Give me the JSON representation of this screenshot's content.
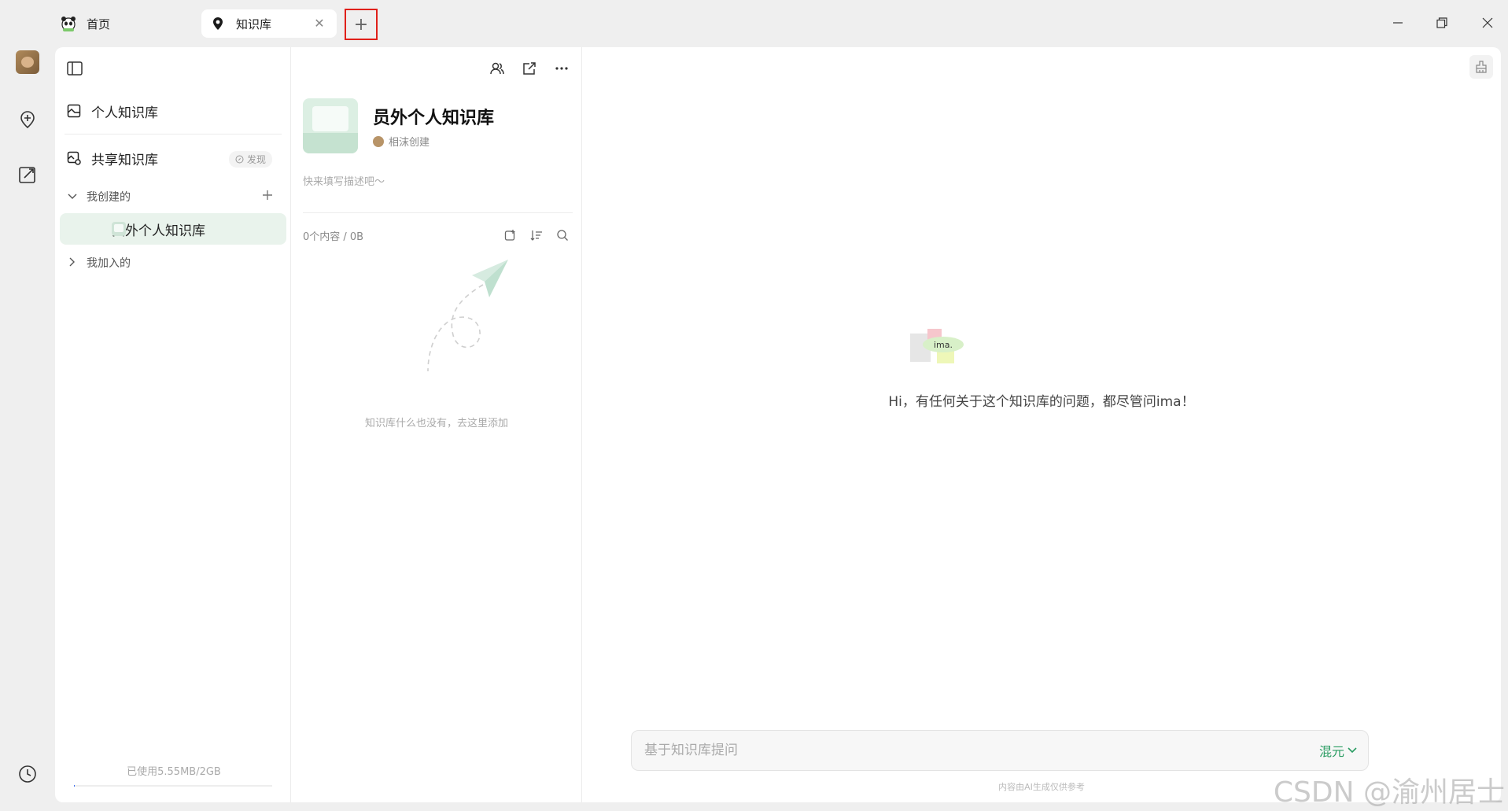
{
  "tabs": [
    {
      "label": "首页",
      "icon": "panda-icon"
    },
    {
      "label": "知识库",
      "icon": "bulb-pin-icon"
    }
  ],
  "new_tab_label": "+",
  "sidebar": {
    "personal_label": "个人知识库",
    "shared_label": "共享知识库",
    "discover_label": "发现",
    "created_group": "我创建的",
    "joined_group": "我加入的",
    "kb_item_label": "员外个人知识库",
    "usage_text": "已使用5.55MB/2GB",
    "usage_fraction": 0.0027
  },
  "detail": {
    "title": "员外个人知识库",
    "creator": "相沫创建",
    "description_placeholder": "快来填写描述吧～",
    "count_text": "0个内容 / 0B",
    "empty_text": "知识库什么也没有，去这里添加"
  },
  "chat": {
    "logo_text": "ima.",
    "greeting": "Hi，有任何关于这个知识库的问题，都尽管问ima！",
    "input_placeholder": "基于知识库提问",
    "model_label": "混元",
    "disclaimer": "内容由AI生成仅供参考"
  },
  "watermark": "CSDN @渝州居士",
  "colors": {
    "accent_green": "#2a9c62",
    "selected_bg": "#e9f3ec",
    "highlight_red": "#e0201a"
  }
}
